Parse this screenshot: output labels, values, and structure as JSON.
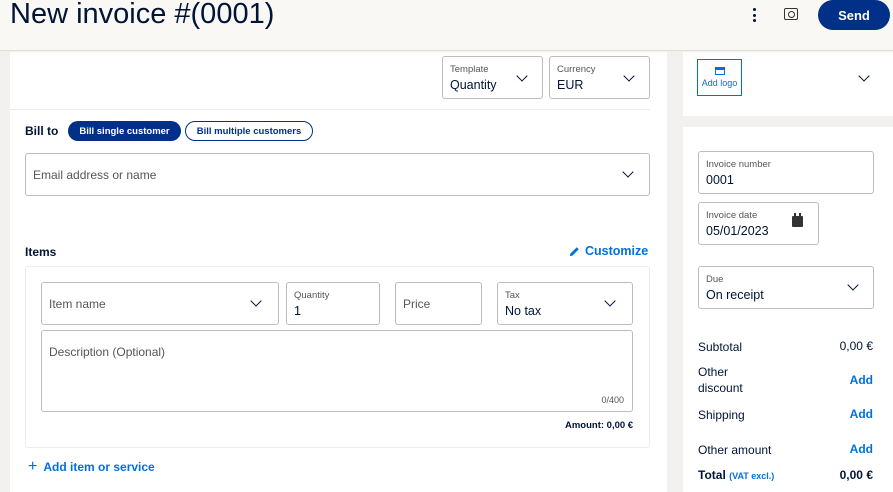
{
  "header": {
    "title": "New invoice #(0001)",
    "more_icon": "more-vertical-icon",
    "preview_icon": "preview-icon",
    "send_label": "Send"
  },
  "settings": {
    "template_label": "Template",
    "template_value": "Quantity",
    "currency_label": "Currency",
    "currency_value": "EUR"
  },
  "bill_to": {
    "label": "Bill to",
    "single_label": "Bill single customer",
    "multiple_label": "Bill multiple customers",
    "email_placeholder": "Email address or name"
  },
  "items": {
    "label": "Items",
    "customize_label": "Customize",
    "item_name_placeholder": "Item name",
    "quantity_label": "Quantity",
    "quantity_value": "1",
    "price_placeholder": "Price",
    "tax_label": "Tax",
    "tax_value": "No tax",
    "description_placeholder": "Description (Optional)",
    "char_counter": "0/400",
    "amount_text": "Amount: 0,00 €",
    "add_item_label": "Add item or service"
  },
  "sidebar": {
    "add_logo_label": "Add logo",
    "invoice_number_label": "Invoice number",
    "invoice_number_value": "0001",
    "invoice_date_label": "Invoice date",
    "invoice_date_value": "05/01/2023",
    "due_label": "Due",
    "due_value": "On receipt",
    "subtotal_label": "Subtotal",
    "subtotal_value": "0,00 €",
    "other_discount_label": "Other discount",
    "shipping_label": "Shipping",
    "other_amount_label": "Other amount",
    "add_label": "Add",
    "total_label": "Total",
    "vat_label": "(VAT excl.)",
    "total_value": "0,00 €"
  },
  "colors": {
    "brand": "#003087",
    "link": "#0070e0",
    "text": "#001435"
  }
}
